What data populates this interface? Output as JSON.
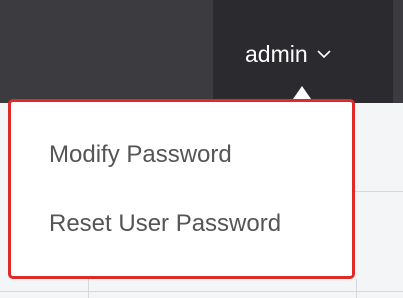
{
  "header": {
    "user_label": "admin",
    "user_icon": "chevron-down-icon"
  },
  "user_menu": {
    "items": [
      {
        "label": "Modify Password"
      },
      {
        "label": "Reset User Password"
      }
    ]
  },
  "colors": {
    "header_dark": "#2b2b2f",
    "header_mid": "#3c3c40",
    "highlight_border": "#e02a2a",
    "menu_text": "#555555"
  }
}
